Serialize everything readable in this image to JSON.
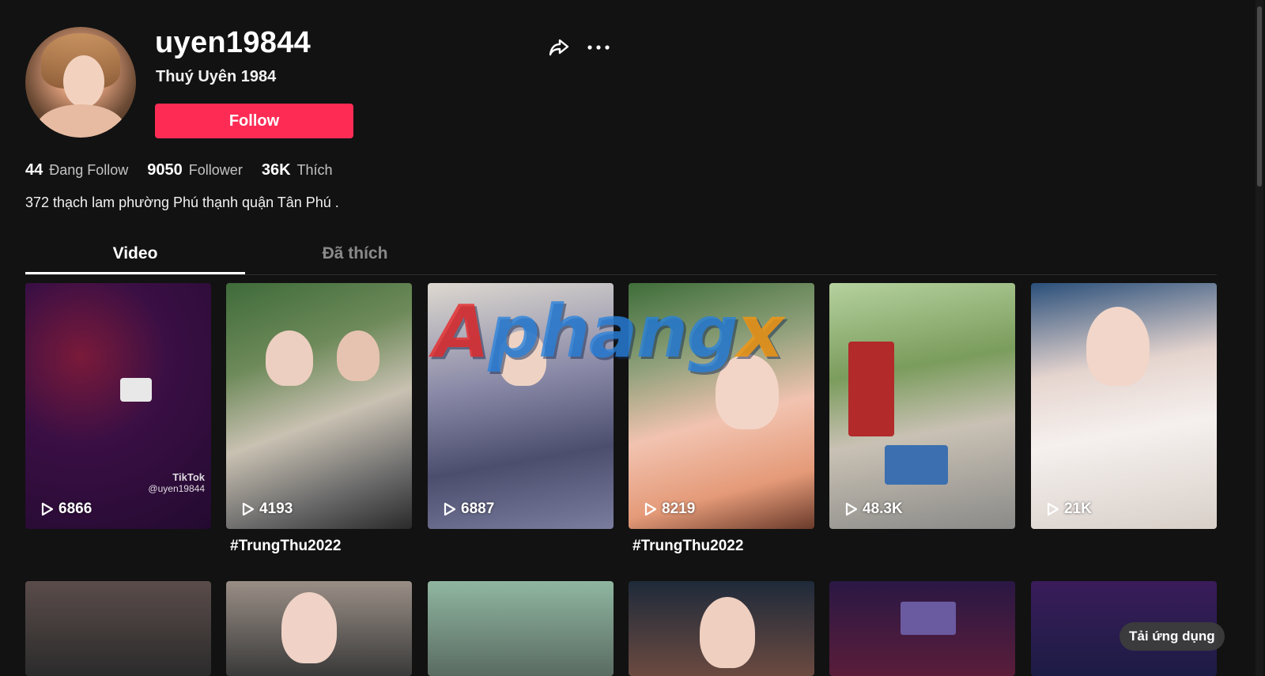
{
  "profile": {
    "username": "uyen19844",
    "nickname": "Thuý Uyên 1984",
    "follow_label": "Follow",
    "bio": "372 thạch lam phường Phú thạnh quận Tân Phú ."
  },
  "stats": [
    {
      "value": "44",
      "label": "Đang Follow"
    },
    {
      "value": "9050",
      "label": "Follower"
    },
    {
      "value": "36K",
      "label": "Thích"
    }
  ],
  "tabs": {
    "video": "Video",
    "liked": "Đã thích",
    "active": "video"
  },
  "videos": [
    {
      "views": "6866",
      "caption": "",
      "watermark_brand": "TikTok",
      "watermark_user": "@uyen19844"
    },
    {
      "views": "4193",
      "caption": "#TrungThu2022"
    },
    {
      "views": "6887",
      "caption": ""
    },
    {
      "views": "8219",
      "caption": "#TrungThu2022"
    },
    {
      "views": "48.3K",
      "caption": ""
    },
    {
      "views": "21K",
      "caption": ""
    }
  ],
  "overlay_watermark": {
    "first": "A",
    "middle": "phang",
    "last": "x"
  },
  "get_app_label": "Tải ứng dụng",
  "colors": {
    "background": "#121212",
    "accent": "#fe2c55"
  },
  "icons": [
    "share-icon",
    "more-icon",
    "play-icon"
  ]
}
